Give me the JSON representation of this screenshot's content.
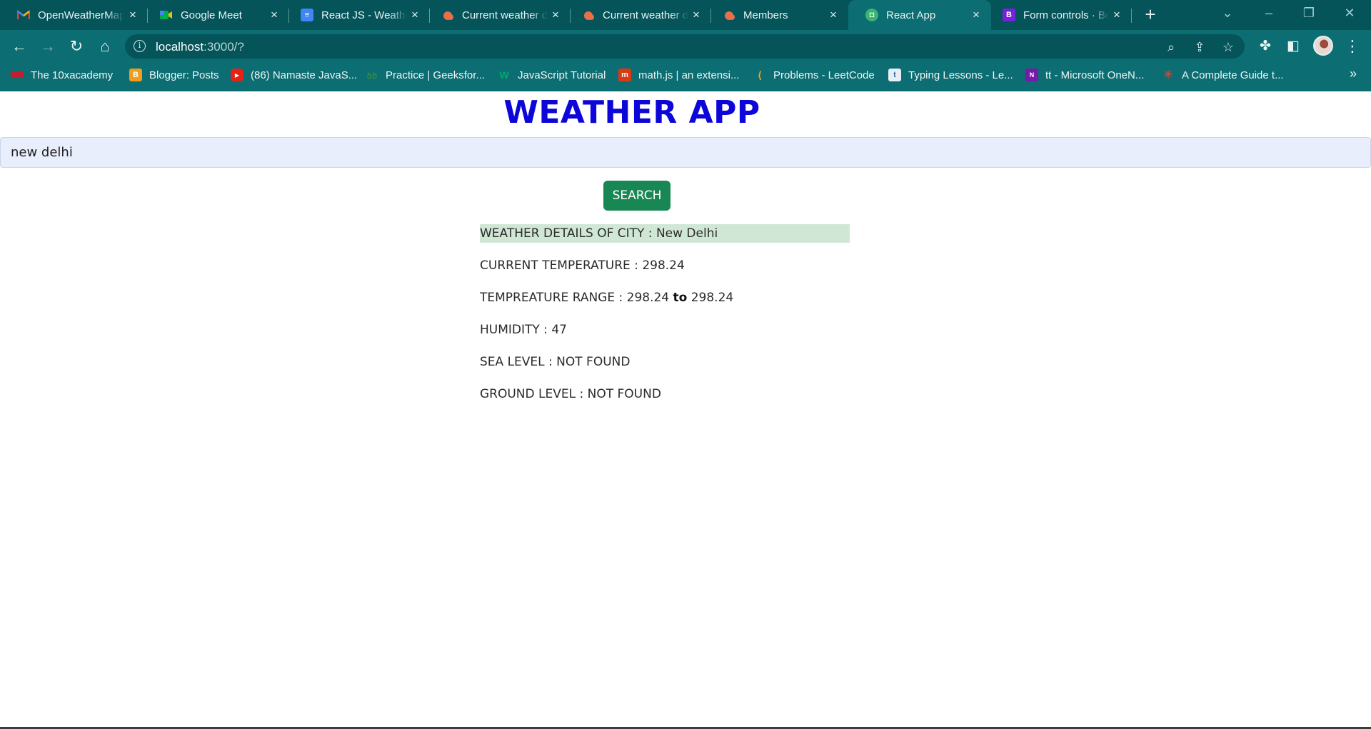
{
  "browser": {
    "tabs": [
      {
        "title": "OpenWeatherMap",
        "icon": "gmail-icon",
        "active": false
      },
      {
        "title": "Google Meet",
        "icon": "google-meet-icon",
        "active": false
      },
      {
        "title": "React JS - Weather",
        "icon": "google-docs-icon",
        "active": false
      },
      {
        "title": "Current weather data",
        "icon": "openweather-icon",
        "active": false
      },
      {
        "title": "Current weather data",
        "icon": "openweather-icon",
        "active": false
      },
      {
        "title": "Members",
        "icon": "openweather-icon",
        "active": false
      },
      {
        "title": "React App",
        "icon": "react-app-icon",
        "active": true
      },
      {
        "title": "Form controls · Bootstrap",
        "icon": "bootstrap-icon",
        "active": false
      }
    ],
    "url_host": "localhost",
    "url_rest": ":3000/?",
    "bookmarks": [
      {
        "label": "The 10xacademy",
        "icon": "10x-icon"
      },
      {
        "label": "Blogger: Posts",
        "icon": "blogger-icon"
      },
      {
        "label": "(86) Namaste JavaS...",
        "icon": "youtube-icon"
      },
      {
        "label": "Practice | Geeksfor...",
        "icon": "geeksforgeeks-icon"
      },
      {
        "label": "JavaScript Tutorial",
        "icon": "w3-icon"
      },
      {
        "label": "math.js | an extensi...",
        "icon": "mathjs-icon"
      },
      {
        "label": "Problems - LeetCode",
        "icon": "leetcode-icon"
      },
      {
        "label": "Typing Lessons - Le...",
        "icon": "typing-icon"
      },
      {
        "label": "tt - Microsoft OneN...",
        "icon": "onenote-icon"
      },
      {
        "label": "A Complete Guide t...",
        "icon": "asterisk-icon"
      }
    ],
    "colors": {
      "chrome_dark": "#04545a",
      "chrome": "#0c6d72"
    }
  },
  "app": {
    "title": "WEATHER APP",
    "search_value": "new delhi",
    "search_button": "SEARCH",
    "details": {
      "city_label": "WEATHER DETAILS OF CITY : ",
      "city": "New Delhi",
      "temp_label": "CURRENT TEMPERATURE : ",
      "temp": "298.24",
      "range_label": "TEMPREATURE RANGE : ",
      "range_min": "298.24",
      "range_to": "to",
      "range_max": "298.24",
      "humidity_label": "HUMIDITY : ",
      "humidity": "47",
      "sea_label": "SEA LEVEL : ",
      "sea": "NOT FOUND",
      "ground_label": "GROUND LEVEL : ",
      "ground": "NOT FOUND"
    },
    "colors": {
      "title": "#0d06d9",
      "button": "#198754",
      "city_highlight": "#d1e7d6"
    }
  }
}
